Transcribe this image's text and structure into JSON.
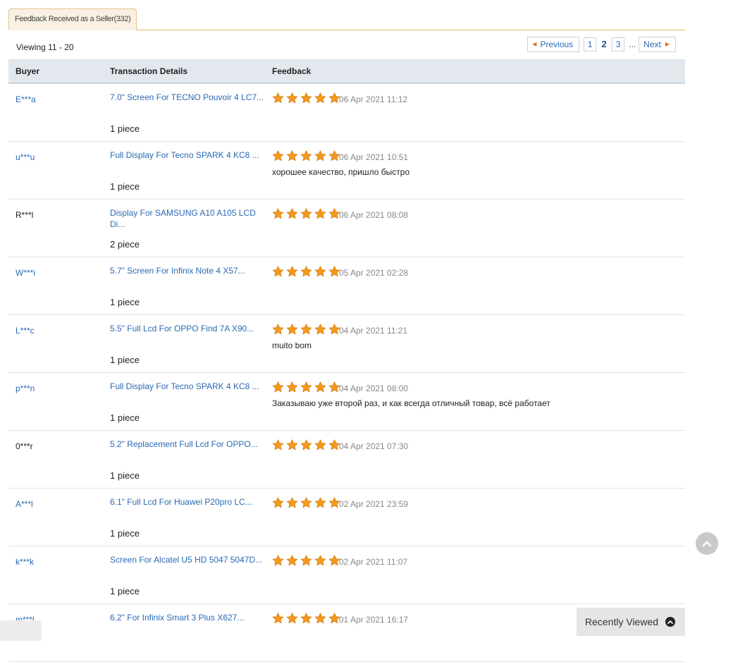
{
  "tab": {
    "label": "Feedback Received as a Seller(332)"
  },
  "viewing": "Viewing 11 - 20",
  "pager": {
    "previous": "Previous",
    "pages": [
      "1",
      "2",
      "3"
    ],
    "current": "2",
    "ellipsis": "...",
    "next": "Next"
  },
  "columns": {
    "buyer": "Buyer",
    "transaction": "Transaction Details",
    "feedback": "Feedback"
  },
  "star_rating_max": 5,
  "rows": [
    {
      "buyer": "E***a",
      "buyer_link": true,
      "title": "7.0\" Screen For TECNO Pouvoir 4 LC7...",
      "qty": "1 piece",
      "rating": 5,
      "date": "06 Apr 2021 11:12",
      "comment": ""
    },
    {
      "buyer": "u***u",
      "buyer_link": true,
      "title": "Full Display For Tecno SPARK 4 KC8 ...",
      "qty": "1 piece",
      "rating": 5,
      "date": "06 Apr 2021 10:51",
      "comment": "хорошее качество, пришло быстро"
    },
    {
      "buyer": "R***l",
      "buyer_link": false,
      "title": "Display For SAMSUNG A10 A105 LCD Di...",
      "qty": "2 piece",
      "rating": 5,
      "date": "06 Apr 2021 08:08",
      "comment": ""
    },
    {
      "buyer": "W***i",
      "buyer_link": true,
      "title": "5.7\" Screen For Infinix Note 4 X57...",
      "qty": "1 piece",
      "rating": 5,
      "date": "05 Apr 2021 02:28",
      "comment": ""
    },
    {
      "buyer": "L***c",
      "buyer_link": true,
      "title": "5.5\" Full Lcd For OPPO Find 7A X90...",
      "qty": "1 piece",
      "rating": 5,
      "date": "04 Apr 2021 11:21",
      "comment": "muito bom"
    },
    {
      "buyer": "p***n",
      "buyer_link": true,
      "title": "Full Display For Tecno SPARK 4 KC8 ...",
      "qty": "1 piece",
      "rating": 5,
      "date": "04 Apr 2021 08:00",
      "comment": "Заказываю уже второй раз, и как всегда отличный товар, всё работает"
    },
    {
      "buyer": "0***r",
      "buyer_link": false,
      "title": "5.2\" Replacement Full Lcd For OPPO...",
      "qty": "1 piece",
      "rating": 5,
      "date": "04 Apr 2021 07:30",
      "comment": ""
    },
    {
      "buyer": "A***l",
      "buyer_link": true,
      "title": "6.1\" Full Lcd For Huawei P20pro LC...",
      "qty": "1 piece",
      "rating": 5,
      "date": "02 Apr 2021 23:59",
      "comment": ""
    },
    {
      "buyer": "k***k",
      "buyer_link": true,
      "title": "Screen For Alcatel U5 HD 5047 5047D...",
      "qty": "1 piece",
      "rating": 5,
      "date": "02 Apr 2021 11:07",
      "comment": ""
    },
    {
      "buyer": "m***l",
      "buyer_link": true,
      "title": "6.2\" For Infinix Smart 3 Plus X627...",
      "qty": "",
      "rating": 5,
      "date": "01 Apr 2021 16:17",
      "comment": ""
    }
  ],
  "recently_viewed": "Recently Viewed",
  "colors": {
    "link": "#2a6ab3",
    "star": "#f39a1e",
    "header_bg": "#e3e7ee",
    "tab_border": "#f0b75c"
  }
}
